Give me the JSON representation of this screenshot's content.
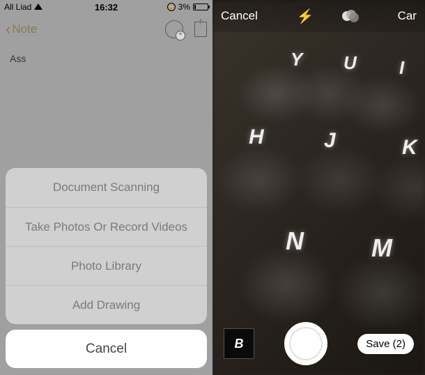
{
  "left": {
    "status": {
      "carrier": "All Liad",
      "time": "16:32",
      "battery_pct": "3%"
    },
    "nav": {
      "back_label": "Note"
    },
    "note": {
      "text": "Ass"
    },
    "action_sheet": {
      "items": [
        "Document Scanning",
        "Take Photos Or Record Videos",
        "Photo Library",
        "Add Drawing"
      ],
      "cancel": "Cancel"
    }
  },
  "right": {
    "toolbar": {
      "cancel": "Cancel",
      "right_label": "Car"
    },
    "keyboard_letters": {
      "k1": "Y",
      "k2": "U",
      "k3": "I",
      "k4": "H",
      "k5": "J",
      "k6": "K",
      "k7": "N",
      "k8": "M"
    },
    "bottom": {
      "thumb_letter": "B",
      "save_label": "Save (2)"
    }
  }
}
